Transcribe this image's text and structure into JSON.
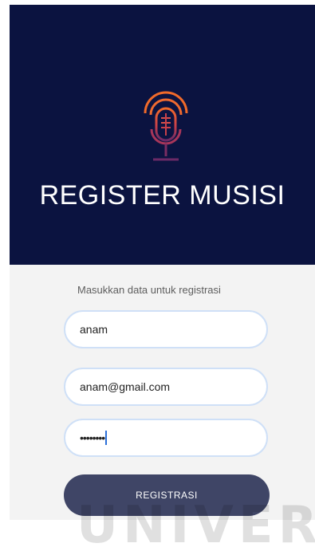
{
  "header": {
    "title": "REGISTER MUSISI",
    "logo_icon": "microphone-icon",
    "background_color": "#0b1340"
  },
  "form": {
    "instruction": "Masukkan data untuk registrasi",
    "fields": [
      {
        "name": "username",
        "value": "anam",
        "placeholder": ""
      },
      {
        "name": "email",
        "value": "anam@gmail.com",
        "placeholder": ""
      },
      {
        "name": "password",
        "value": "••••••••",
        "placeholder": ""
      }
    ],
    "submit_label": "REGISTRASI",
    "button_color": "#3f4566"
  },
  "watermark_text": "UNIVERS"
}
